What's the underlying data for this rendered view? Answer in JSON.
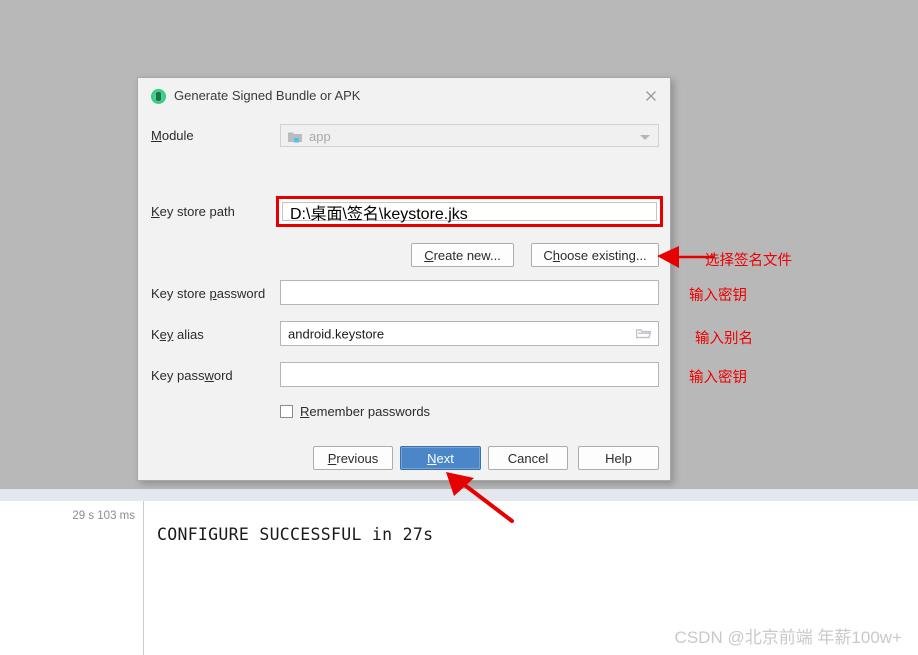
{
  "colors": {
    "overlay": "#b8b8b8",
    "dialog_bg": "#f2f2f2",
    "accent_blue": "#4a86c8",
    "annotation_red": "#ee0000",
    "highlight_red": "#e60000",
    "console_strip": "#e4e7ed",
    "watermark": "#c9c9c9"
  },
  "dialog": {
    "title": "Generate Signed Bundle or APK",
    "app_icon": "android-studio-icon",
    "close_icon": "close-icon",
    "module": {
      "label": "Module",
      "mnemonic": "M",
      "value": "app",
      "icon": "module-folder-icon",
      "dropdown_icon": "chevron-down-icon",
      "enabled": false
    },
    "key_store_path": {
      "label": "Key store path",
      "mnemonic": "K",
      "value": "D:\\桌面\\签名\\keystore.jks",
      "placeholder": "",
      "highlighted": true
    },
    "create_new_button": {
      "label": "Create new...",
      "mnemonic": "C"
    },
    "choose_existing_button": {
      "label": "Choose existing...",
      "mnemonic": "h"
    },
    "key_store_password": {
      "label": "Key store password",
      "mnemonic": "p",
      "value": "",
      "placeholder": ""
    },
    "key_alias": {
      "label": "Key alias",
      "mnemonic": "ey",
      "value": "android.keystore",
      "placeholder": "",
      "icon": "folder-browse-icon"
    },
    "key_password": {
      "label": "Key password",
      "mnemonic": "w",
      "value": "",
      "placeholder": ""
    },
    "remember_passwords": {
      "label": "Remember passwords",
      "mnemonic": "R",
      "checked": false
    },
    "buttons": {
      "previous": "Previous",
      "next": "Next",
      "cancel": "Cancel",
      "help": "Help"
    }
  },
  "annotations": [
    {
      "text": "选择签名文件",
      "target": "choose-existing-button"
    },
    {
      "text": "输入密钥",
      "target": "key-store-password-field"
    },
    {
      "text": "输入别名",
      "target": "key-alias-field"
    },
    {
      "text": "输入密钥",
      "target": "key-password-field"
    }
  ],
  "build_panel": {
    "duration": "29 s 103 ms",
    "output": "CONFIGURE SUCCESSFUL in 27s"
  },
  "watermark": "CSDN @北京前端 年薪100w+"
}
